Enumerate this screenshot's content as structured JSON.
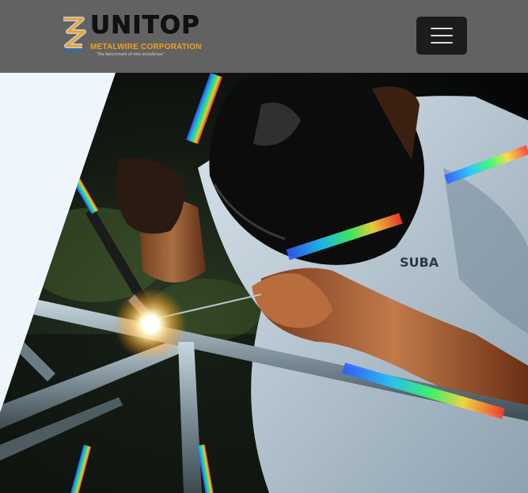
{
  "header": {
    "brand": {
      "title": "UNITOP",
      "subtitle": "METALWIRE CORPORATION",
      "tagline": "\"the benchmark of wire excellence\"",
      "colors": {
        "title": "#111111",
        "subtitle": "#f0a11a",
        "mark_blue": "#2d6fb8"
      }
    },
    "menu_toggle": {
      "icon": "hamburger-icon"
    },
    "background": "#626262"
  },
  "hero": {
    "image": "welder-welding-metal-frame-photo",
    "shirt_text": "SUBA",
    "background": "#eef5fb"
  }
}
